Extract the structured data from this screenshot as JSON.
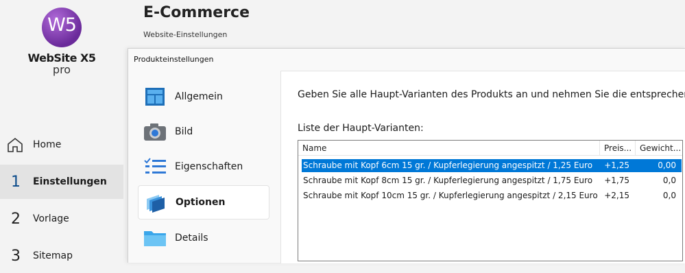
{
  "app": {
    "logo_glyph": "W5",
    "logo_name": "WebSite X5",
    "logo_edition": "pro"
  },
  "header": {
    "title": "E-Commerce",
    "subtitle": "Website-Einstellungen"
  },
  "nav": [
    {
      "num": "",
      "label": "Home",
      "icon": "home-icon"
    },
    {
      "num": "1",
      "label": "Einstellungen"
    },
    {
      "num": "2",
      "label": "Vorlage"
    },
    {
      "num": "3",
      "label": "Sitemap"
    }
  ],
  "dialog": {
    "title": "Produkteinstellungen",
    "nav": [
      {
        "label": "Allgemein",
        "icon": "window-icon"
      },
      {
        "label": "Bild",
        "icon": "camera-icon"
      },
      {
        "label": "Eigenschaften",
        "icon": "checklist-icon"
      },
      {
        "label": "Optionen",
        "icon": "layers-icon"
      },
      {
        "label": "Details",
        "icon": "folder-icon"
      }
    ],
    "instruction": "Geben Sie alle Haupt-Varianten des Produkts an und nehmen Sie die entsprechenden",
    "instruction_cut": "E",
    "list_label": "Liste der Haupt-Varianten:",
    "columns": [
      "Name",
      "Preis...",
      "Gewicht..."
    ],
    "rows": [
      {
        "name": "Schraube mit Kopf  6cm 15 gr. / Kupferlegierung angespitzt / 1,25 Euro",
        "price": "+1,25",
        "weight": "0,00"
      },
      {
        "name": "Schraube mit Kopf  8cm 15 gr. / Kupferlegierung angespitzt / 1,75 Euro",
        "price": "+1,75",
        "weight": "0,0"
      },
      {
        "name": "Schraube mit Kopf  10cm 15 gr. / Kupferlegierung angespitzt / 2,15 Euro",
        "price": "+2,15",
        "weight": "0,0"
      }
    ]
  },
  "colors": {
    "accent": "#0078d7",
    "logo": "#8a3fbf"
  }
}
